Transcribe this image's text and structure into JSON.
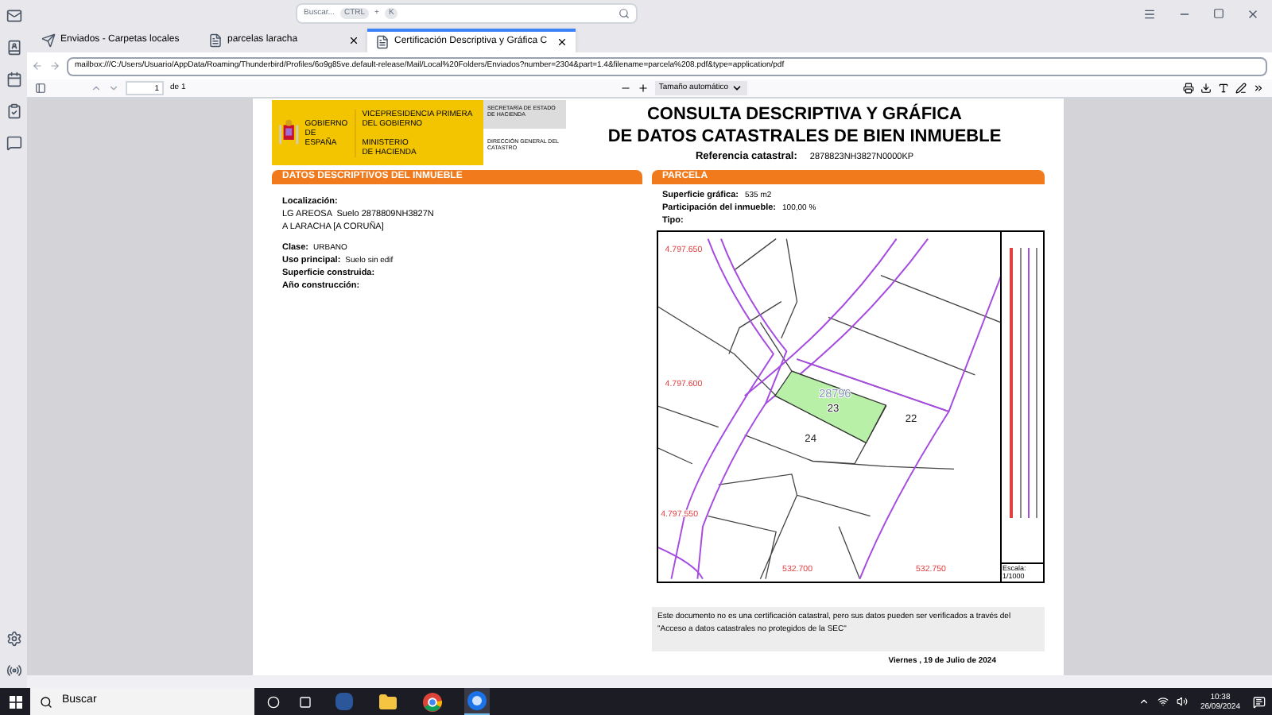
{
  "search": {
    "placeholder": "Buscar...",
    "keys": [
      "CTRL",
      "K"
    ],
    "separator": "+"
  },
  "tabs": [
    {
      "label": "Enviados - Carpetas locales",
      "selected": false,
      "closable": false,
      "kind": "mail"
    },
    {
      "label": "parcelas laracha",
      "selected": false,
      "closable": true,
      "kind": "doc"
    },
    {
      "label": "Certificación Descriptiva y Gráfica C",
      "selected": true,
      "closable": true,
      "kind": "doc"
    }
  ],
  "url": "mailbox:///C:/Users/Usuario/AppData/Roaming/Thunderbird/Profiles/6o9g85ve.default-release/Mail/Local%20Folders/Enviados?number=2304&part=1.4&filename=parcela%208.pdf&type=application/pdf",
  "pdf_toolbar": {
    "page": "1",
    "page_count": "de 1",
    "zoom": "Tamaño automático"
  },
  "document": {
    "header": {
      "gov": "GOBIERNO DE ESPAÑA",
      "vice": "VICEPRESIDENCIA PRIMERA DEL GOBIERNO",
      "ministry": "MINISTERIO DE HACIENDA",
      "secretary": "SECRETARÍA DE ESTADO DE HACIENDA",
      "directorate": "DIRECCIÓN GENERAL DEL CATASTRO"
    },
    "title": [
      "CONSULTA DESCRIPTIVA Y GRÁFICA",
      "DE DATOS CATASTRALES DE BIEN INMUEBLE"
    ],
    "reference": {
      "label": "Referencia catastral:",
      "value": "2878823NH3827N0000KP"
    },
    "descriptive": {
      "title": "DATOS DESCRIPTIVOS DEL INMUEBLE",
      "location_label": "Localización:",
      "location_lines": [
        "LG AREOSA  Suelo 2878809NH3827N",
        "A LARACHA [A CORUÑA]"
      ],
      "fields": [
        {
          "label": "Clase:",
          "value": "URBANO"
        },
        {
          "label": "Uso principal:",
          "value": "Suelo sin edif"
        },
        {
          "label": "Superficie construida:"
        },
        {
          "label": "Año construcción:"
        }
      ]
    },
    "parcel": {
      "title": "PARCELA",
      "fields": [
        {
          "label": "Superficie gráfica:",
          "value": "535 m2"
        },
        {
          "label": "Participación del inmueble:",
          "value": "100,00 %"
        },
        {
          "label": "Tipo:"
        }
      ],
      "map_labels": [
        {
          "text": "4.797.650",
          "kind": "coord"
        },
        {
          "text": "4.797.600",
          "kind": "coord"
        },
        {
          "text": "4.797.550",
          "kind": "coord"
        },
        {
          "text": "532.700",
          "kind": "coord"
        },
        {
          "text": "532.750",
          "kind": "coord"
        },
        {
          "text": "28796",
          "kind": "block"
        },
        {
          "text": "23",
          "kind": "plot"
        },
        {
          "text": "22",
          "kind": "plot"
        },
        {
          "text": "24",
          "kind": "plot"
        }
      ],
      "scale_label": "Escala:",
      "scale": "1/1000"
    },
    "note": "Este documento no es una certificación catastral, pero sus datos pueden ser verificados a través del \"Acceso a datos catastrales no protegidos de la SEC\"",
    "date": "Viernes , 19 de Julio de 2024"
  },
  "taskbar": {
    "search": "Buscar",
    "time": "10:38",
    "date": "26/09/2024",
    "apps": [
      {
        "kind": "word",
        "active": false
      },
      {
        "kind": "explorer",
        "active": false
      },
      {
        "kind": "chrome",
        "active": false
      },
      {
        "kind": "thunderbird",
        "active": true
      }
    ]
  }
}
